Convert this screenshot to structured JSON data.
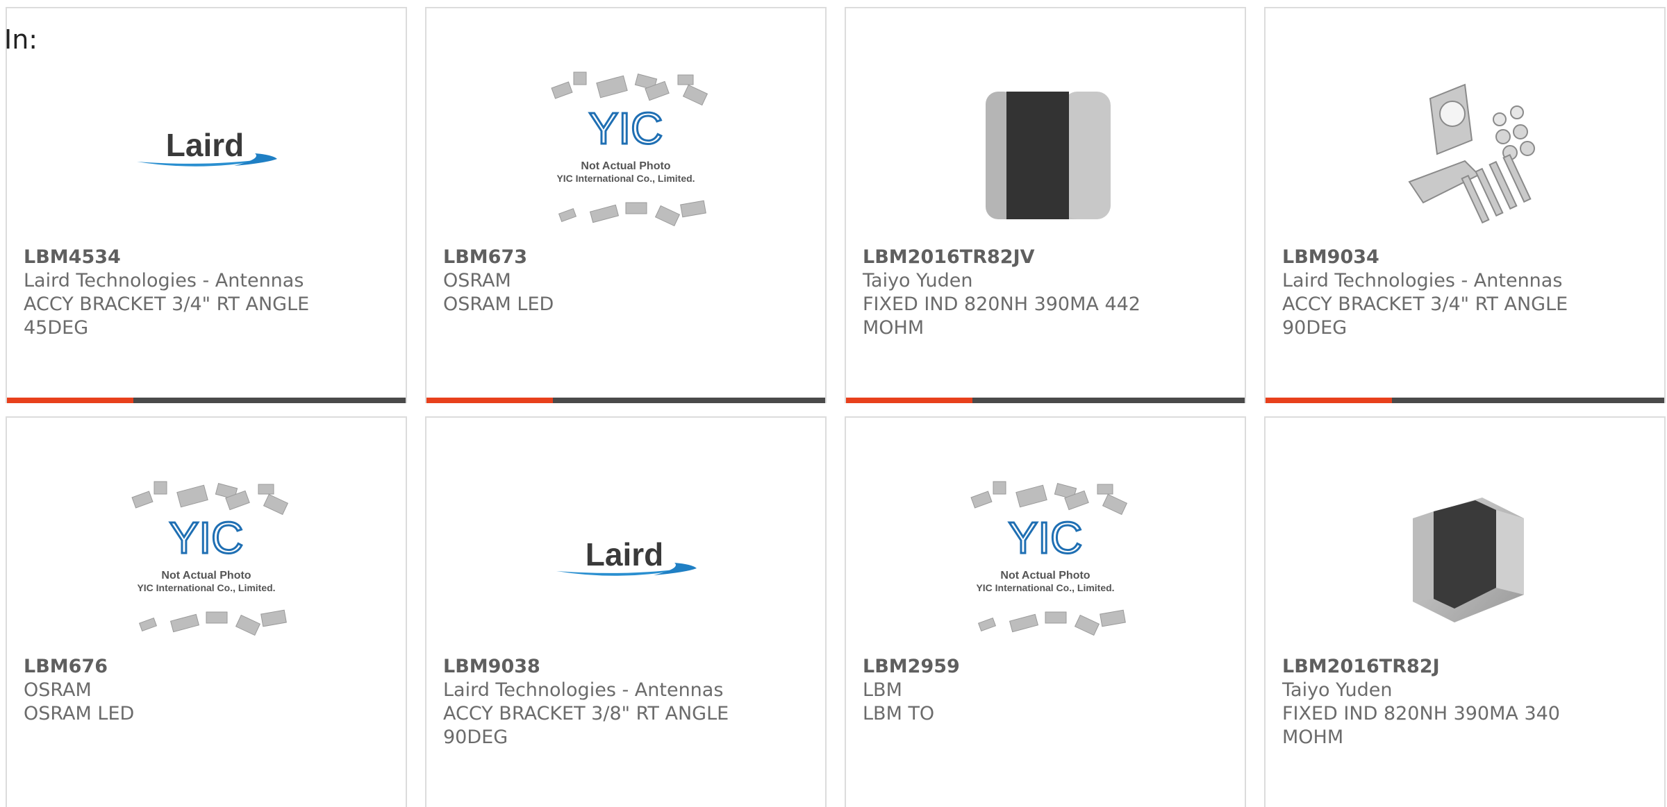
{
  "header": {
    "filter_label": "In:"
  },
  "colors": {
    "accent": "#e8401c",
    "bar": "#4a4a4a",
    "border": "#dcdcdc"
  },
  "products": [
    {
      "part_number": "LBM4534",
      "manufacturer": "Laird Technologies - Antennas",
      "description": "ACCY BRACKET 3/4\" RT ANGLE 45DEG",
      "image": "laird-logo",
      "logo_text": "Laird"
    },
    {
      "part_number": "LBM673",
      "manufacturer": "OSRAM",
      "description": "OSRAM LED",
      "image": "yic-placeholder",
      "logo_text": "YIC",
      "note_line1": "Not Actual Photo",
      "note_line2": "YIC International Co., Limited."
    },
    {
      "part_number": "LBM2016TR82JV",
      "manufacturer": "Taiyo Yuden",
      "description": "FIXED IND 820NH 390MA 442 MOHM",
      "image": "inductor-photo"
    },
    {
      "part_number": "LBM9034",
      "manufacturer": "Laird Technologies - Antennas",
      "description": "ACCY BRACKET 3/4\" RT ANGLE 90DEG",
      "image": "bracket-photo"
    },
    {
      "part_number": "LBM676",
      "manufacturer": "OSRAM",
      "description": "OSRAM LED",
      "image": "yic-placeholder",
      "logo_text": "YIC",
      "note_line1": "Not Actual Photo",
      "note_line2": "YIC International Co., Limited."
    },
    {
      "part_number": "LBM9038",
      "manufacturer": "Laird Technologies - Antennas",
      "description": "ACCY BRACKET 3/8\" RT ANGLE 90DEG",
      "image": "laird-logo",
      "logo_text": "Laird"
    },
    {
      "part_number": "LBM2959",
      "manufacturer": "LBM",
      "description": "LBM TO",
      "image": "yic-placeholder",
      "logo_text": "YIC",
      "note_line1": "Not Actual Photo",
      "note_line2": "YIC International Co., Limited."
    },
    {
      "part_number": "LBM2016TR82J",
      "manufacturer": "Taiyo Yuden",
      "description": "FIXED IND 820NH 390MA 340 MOHM",
      "image": "inductor-photo-small"
    }
  ]
}
